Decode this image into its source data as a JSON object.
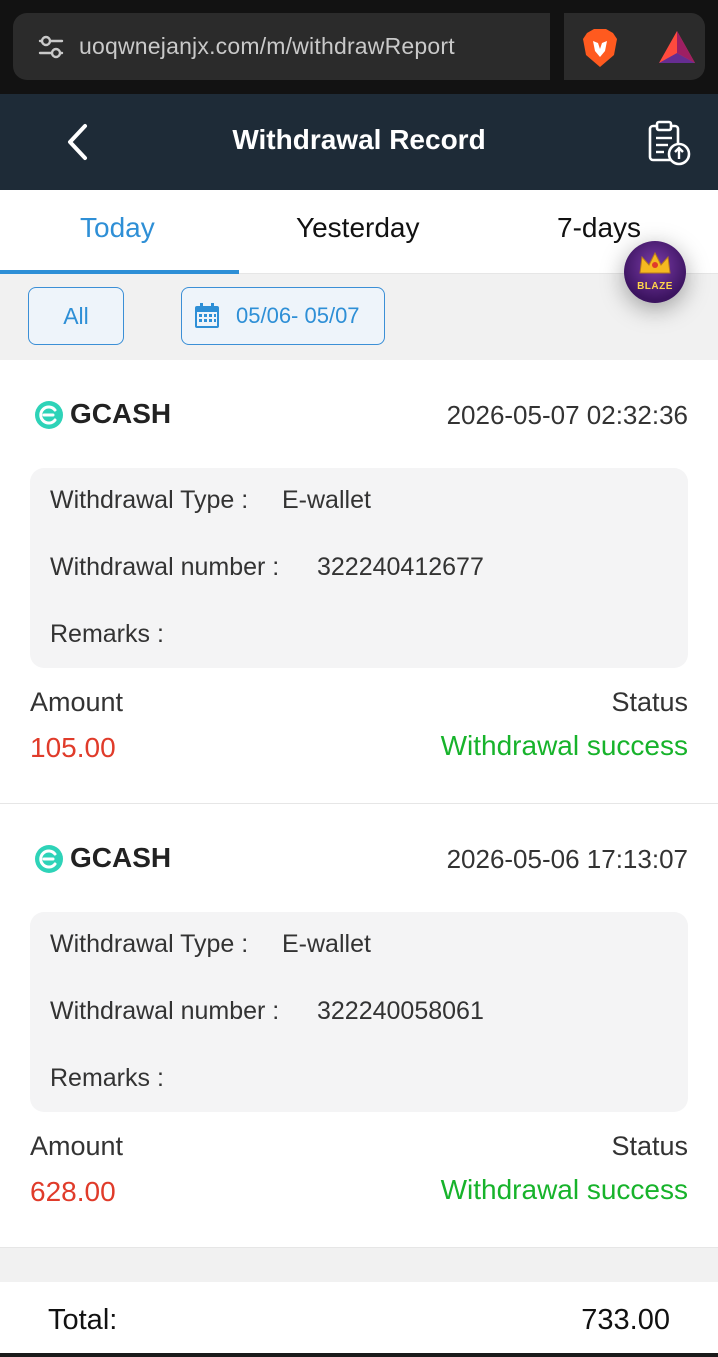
{
  "browser": {
    "url": "uoqwnejanjx.com/m/withdrawReport"
  },
  "header": {
    "title": "Withdrawal Record"
  },
  "tabs": [
    {
      "label": "Today",
      "active": true
    },
    {
      "label": "Yesterday",
      "active": false
    },
    {
      "label": "7-days",
      "active": false
    }
  ],
  "filters": {
    "all_label": "All",
    "date_range": "05/06- 05/07"
  },
  "floating_badge": {
    "text": "BLAZE"
  },
  "records": [
    {
      "method": "GCASH",
      "datetime": "2026-05-07 02:32:36",
      "type_label": "Withdrawal Type :",
      "type_value": "E-wallet",
      "number_label": "Withdrawal number :",
      "number_value": "322240412677",
      "remarks_label": "Remarks :",
      "remarks_value": "",
      "amount_label": "Amount",
      "amount": "105.00",
      "status_label": "Status",
      "status": "Withdrawal success"
    },
    {
      "method": "GCASH",
      "datetime": "2026-05-06 17:13:07",
      "type_label": "Withdrawal Type :",
      "type_value": "E-wallet",
      "number_label": "Withdrawal number :",
      "number_value": "322240058061",
      "remarks_label": "Remarks :",
      "remarks_value": "",
      "amount_label": "Amount",
      "amount": "628.00",
      "status_label": "Status",
      "status": "Withdrawal success"
    }
  ],
  "total": {
    "label": "Total:",
    "value": "733.00"
  },
  "colors": {
    "accent": "#2e8fd6",
    "header_bg": "#1e2b37",
    "amount": "#e03b2a",
    "success": "#17b32b",
    "gcash": "#2ed3b8"
  },
  "icons": [
    "tune-icon",
    "brave-lion-icon",
    "bat-triangle-icon",
    "back-arrow-icon",
    "clipboard-upload-icon",
    "calendar-icon",
    "gcash-icon",
    "blaze-logo-icon"
  ]
}
